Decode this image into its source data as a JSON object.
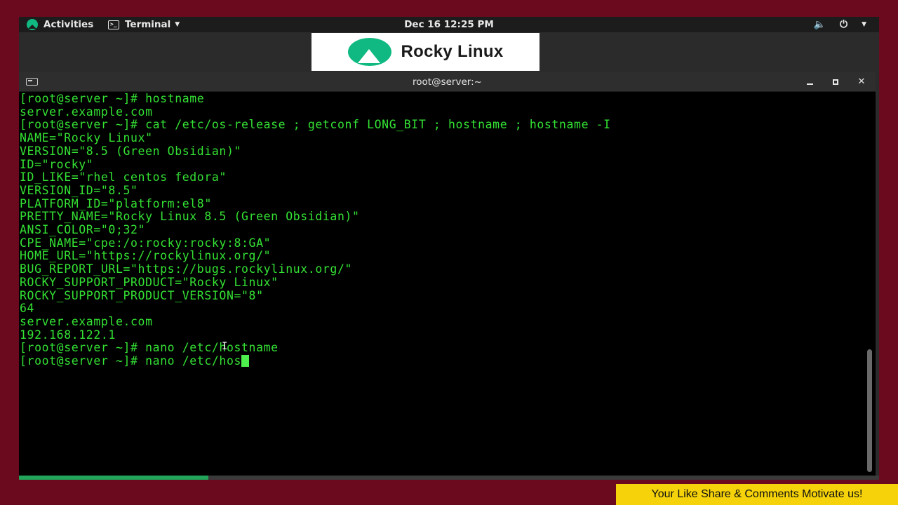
{
  "topbar": {
    "activities": "Activities",
    "app_menu": "Terminal",
    "clock": "Dec 16  12:25 PM",
    "icons": [
      "volume-icon",
      "power-icon",
      "chevron-down-icon"
    ]
  },
  "banner": {
    "logo_text": "Rocky Linux"
  },
  "window": {
    "title": "root@server:~"
  },
  "terminal": {
    "lines": [
      "[root@server ~]# hostname",
      "server.example.com",
      "[root@server ~]# cat /etc/os-release ; getconf LONG_BIT ; hostname ; hostname -I",
      "NAME=\"Rocky Linux\"",
      "VERSION=\"8.5 (Green Obsidian)\"",
      "ID=\"rocky\"",
      "ID_LIKE=\"rhel centos fedora\"",
      "VERSION_ID=\"8.5\"",
      "PLATFORM_ID=\"platform:el8\"",
      "PRETTY_NAME=\"Rocky Linux 8.5 (Green Obsidian)\"",
      "ANSI_COLOR=\"0;32\"",
      "CPE_NAME=\"cpe:/o:rocky:rocky:8:GA\"",
      "HOME_URL=\"https://rockylinux.org/\"",
      "BUG_REPORT_URL=\"https://bugs.rockylinux.org/\"",
      "ROCKY_SUPPORT_PRODUCT=\"Rocky Linux\"",
      "ROCKY_SUPPORT_PRODUCT_VERSION=\"8\"",
      "64",
      "server.example.com",
      "192.168.122.1",
      "[root@server ~]# nano /etc/hostname"
    ],
    "current_input": "[root@server ~]# nano /etc/hos"
  },
  "video_progress": 0.22,
  "colors": {
    "terminal_text": "#34e234",
    "background": "#6b0a1e",
    "promo_bg": "#f5d20a"
  },
  "promo": {
    "text": "Your Like Share & Comments Motivate us!"
  }
}
